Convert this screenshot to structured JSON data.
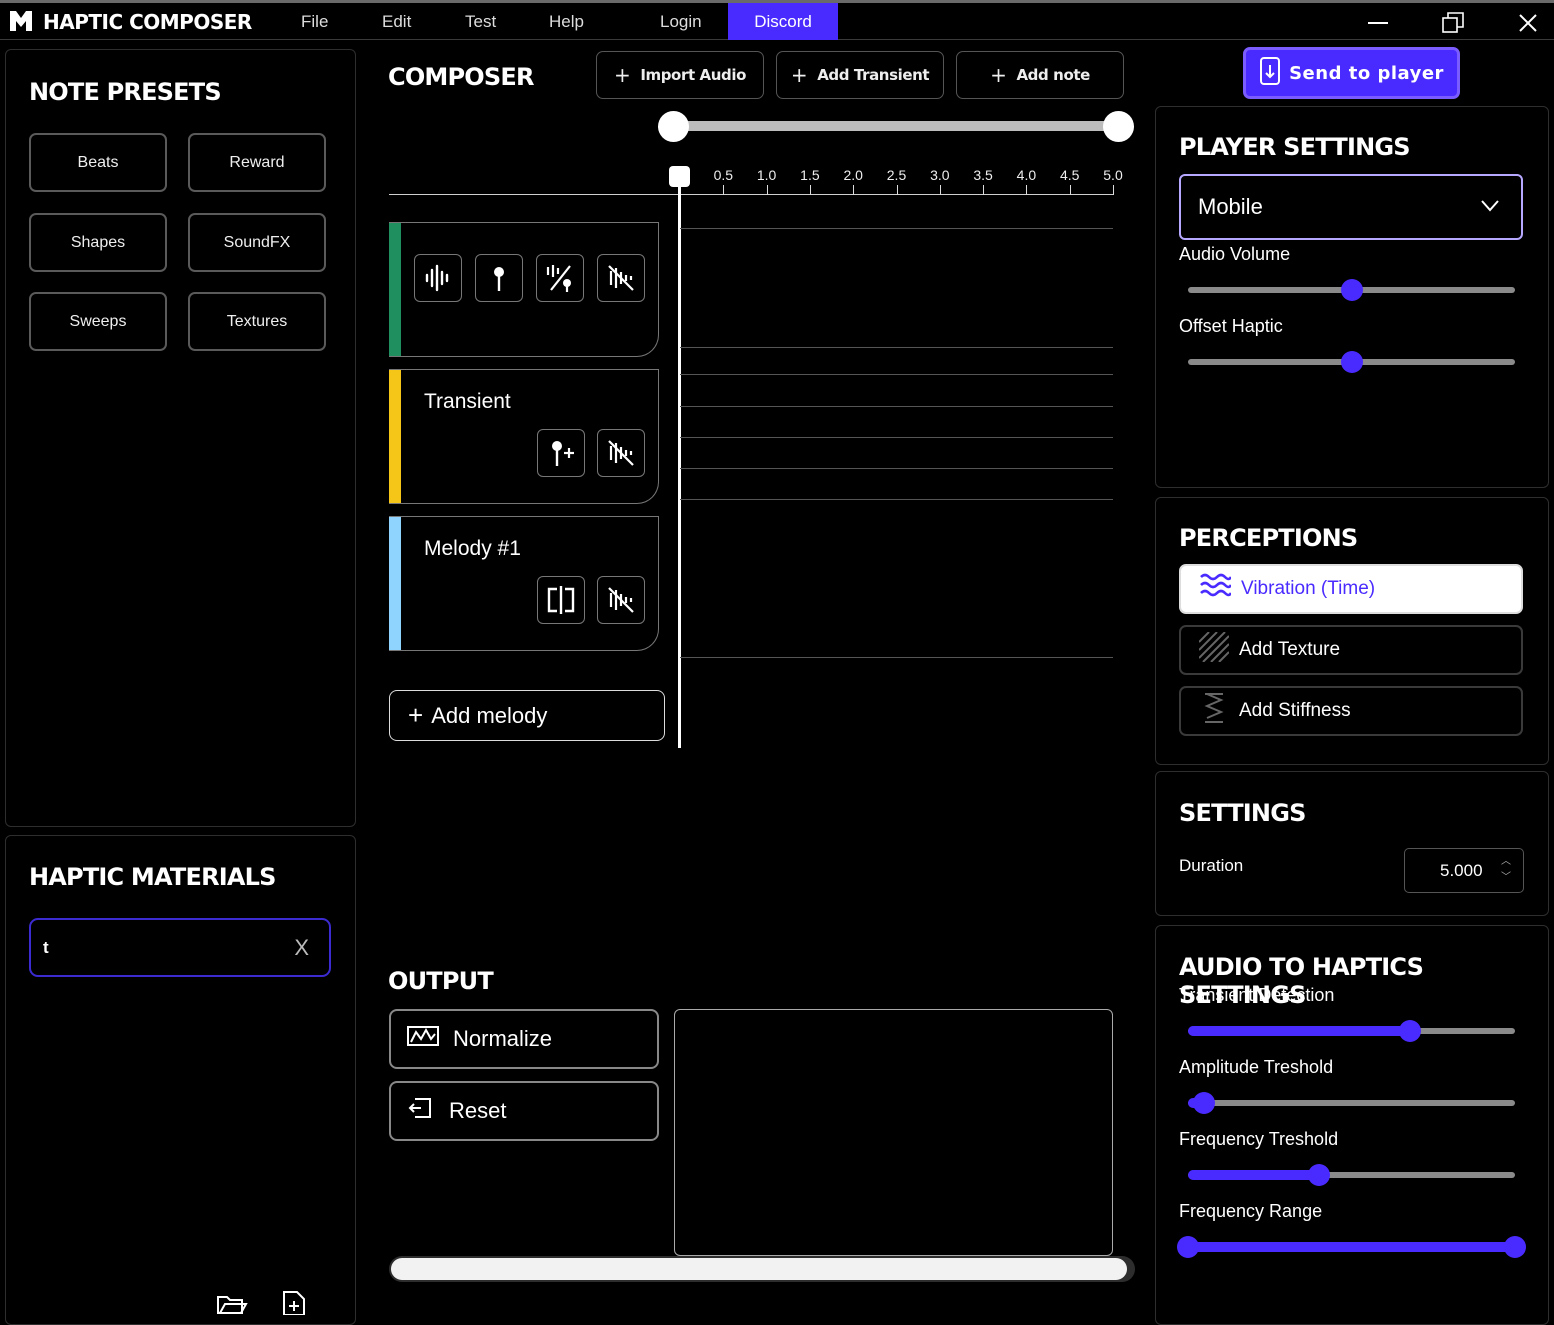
{
  "app": {
    "title": "HAPTIC COMPOSER"
  },
  "menu": {
    "file": "File",
    "edit": "Edit",
    "test": "Test",
    "help": "Help",
    "login": "Login",
    "discord": "Discord"
  },
  "note_presets": {
    "title": "NOTE PRESETS",
    "items": [
      "Beats",
      "Reward",
      "Shapes",
      "SoundFX",
      "Sweeps",
      "Textures"
    ]
  },
  "haptic_materials": {
    "title": "HAPTIC MATERIALS",
    "search_value": "t",
    "clear_label": "X"
  },
  "composer": {
    "title": "COMPOSER",
    "buttons": {
      "import_audio": "Import Audio",
      "add_transient": "Add Transient",
      "add_note": "Add note"
    },
    "timeline_ticks": [
      "0.5",
      "1.0",
      "1.5",
      "2.0",
      "2.5",
      "3.0",
      "3.5",
      "4.0",
      "4.5",
      "5.0"
    ],
    "tracks": [
      {
        "label": "",
        "color": "#1f8f5f"
      },
      {
        "label": "Transient",
        "color": "#f5c518"
      },
      {
        "label": "Melody #1",
        "color": "#8fd3ff"
      }
    ],
    "add_melody": "Add melody"
  },
  "output": {
    "title": "OUTPUT",
    "normalize": "Normalize",
    "reset": "Reset"
  },
  "send_to_player": "Send to player",
  "player_settings": {
    "title": "PLAYER SETTINGS",
    "device": "Mobile",
    "audio_volume_label": "Audio Volume",
    "audio_volume": 0.5,
    "offset_haptic_label": "Offset Haptic",
    "offset_haptic": 0.5
  },
  "perceptions": {
    "title": "PERCEPTIONS",
    "vibration": "Vibration (Time)",
    "add_texture": "Add Texture",
    "add_stiffness": "Add Stiffness"
  },
  "settings": {
    "title": "SETTINGS",
    "duration_label": "Duration",
    "duration_value": "5.000"
  },
  "audio_to_haptics": {
    "title": "AUDIO TO HAPTICS SETTINGS",
    "transient_detection_label": "Transient Detection",
    "transient_detection": 0.68,
    "amplitude_threshold_label": "Amplitude Treshold",
    "amplitude_threshold": 0.05,
    "frequency_threshold_label": "Frequency Treshold",
    "frequency_threshold": 0.4,
    "frequency_range_label": "Frequency Range",
    "frequency_range": [
      0.0,
      1.0
    ]
  },
  "colors": {
    "accent": "#4a2bff"
  }
}
